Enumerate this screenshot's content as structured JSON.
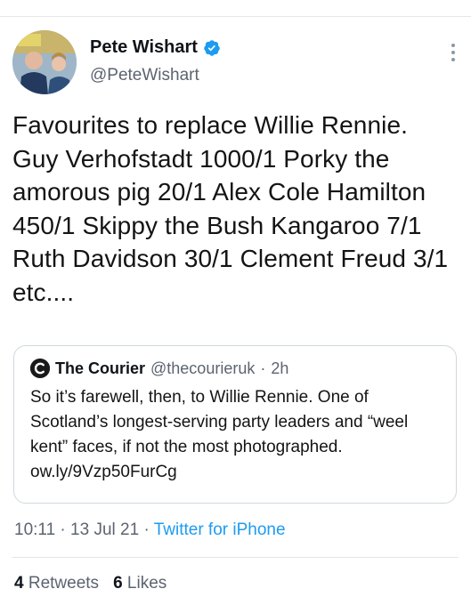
{
  "tweet": {
    "author": {
      "display_name": "Pete Wishart",
      "handle": "@PeteWishart",
      "verified_icon": "verified-badge-icon",
      "avatar_icon": "profile-photo"
    },
    "more_icon": "more-options-icon",
    "text": "Favourites to replace Willie Rennie. Guy Verhofstadt 1000/1 Porky the amorous pig 20/1 Alex Cole Hamilton 450/1 Skippy the Bush Kangaroo 7/1 Ruth Davidson 30/1 Clement Freud 3/1 etc....",
    "quoted": {
      "logo_icon": "courier-logo-icon",
      "name": "The Courier",
      "handle": "@thecourieruk",
      "separator": "·",
      "time": "2h",
      "text": "So it’s farewell, then, to Willie Rennie. One of Scotland’s longest-serving party leaders and “weel kent” faces, if not the most photographed. ow.ly/9Vzp50FurCg"
    },
    "meta": {
      "time": "10:11",
      "sep1": "·",
      "date": "13 Jul 21",
      "sep2": "·",
      "source": "Twitter for iPhone"
    },
    "stats": {
      "retweets_count": "4",
      "retweets_label": "Retweets",
      "likes_count": "6",
      "likes_label": "Likes"
    }
  },
  "colors": {
    "link_blue": "#1d9bf0",
    "secondary_text": "#5b6470",
    "border": "#cfd9de"
  }
}
